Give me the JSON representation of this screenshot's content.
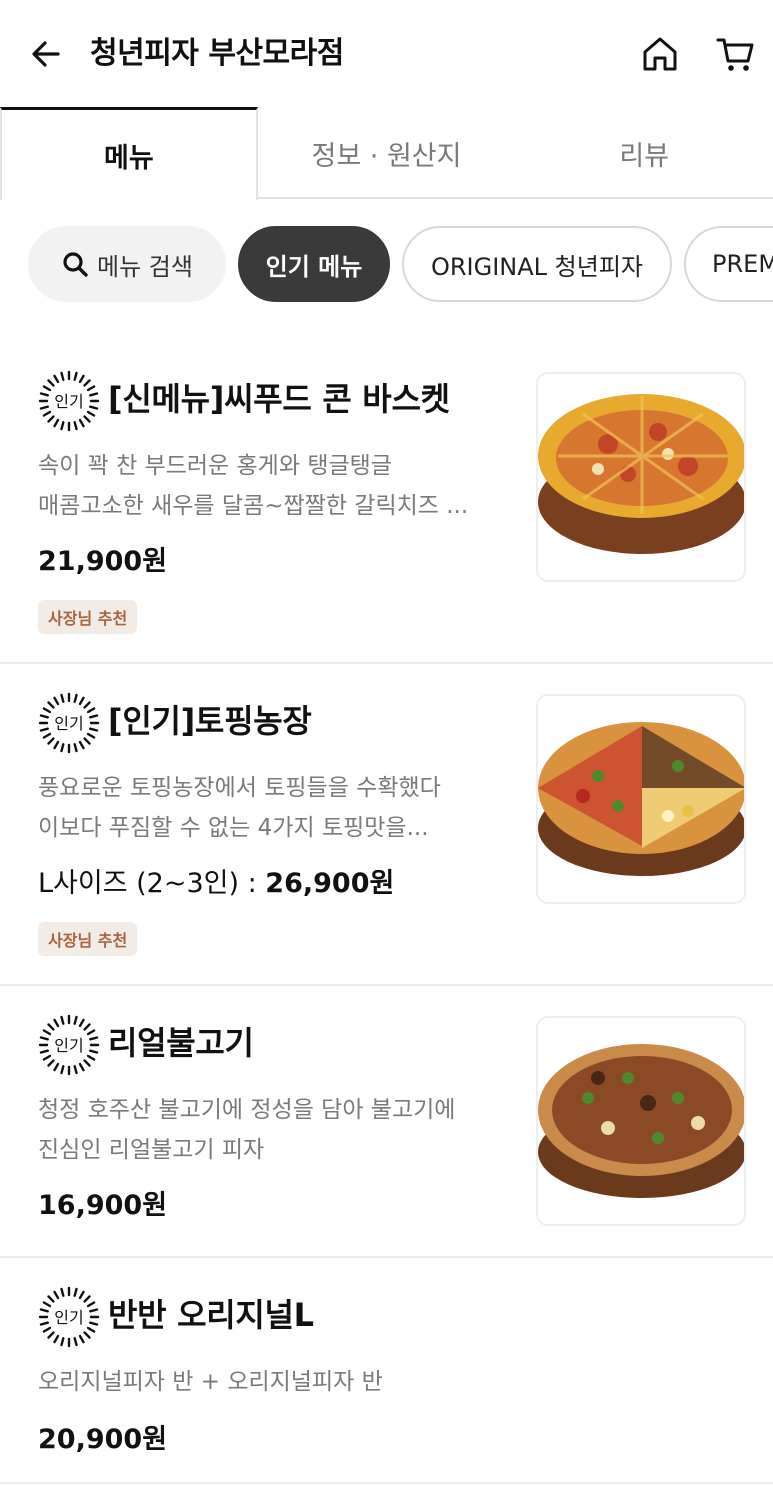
{
  "header": {
    "title": "청년피자 부산모라점",
    "back_icon": "back-arrow-icon",
    "home_icon": "home-icon",
    "cart_icon": "cart-icon"
  },
  "tabs": [
    {
      "label": "메뉴",
      "active": true
    },
    {
      "label": "정보 · 원산지",
      "active": false
    },
    {
      "label": "리뷰",
      "active": false
    }
  ],
  "chips": {
    "search_label": "메뉴 검색",
    "items": [
      {
        "label": "인기 메뉴",
        "active": true
      },
      {
        "label": "ORIGINAL 청년피자",
        "active": false
      },
      {
        "label": "PREMIUM",
        "active": false
      }
    ]
  },
  "badge_text": "인기",
  "menu": [
    {
      "name": "[신메뉴]씨푸드 콘 바스켓",
      "desc_lines": [
        "속이 꽉 찬 부드러운 홍게와 탱글탱글",
        "매콤고소한 새우를 달콤~짭짤한 갈릭치즈 ..."
      ],
      "price_prefix": "",
      "price": "21,900원",
      "recommend": "사장님 추천",
      "pizza_color": "#e5a52f"
    },
    {
      "name": "[인기]토핑농장",
      "desc_lines": [
        "풍요로운 토핑농장에서 토핑들을 수확했다",
        "이보다 푸짐할 수 없는 4가지 토핑맛을..."
      ],
      "price_prefix": "L사이즈 (2~3인) : ",
      "price": "26,900원",
      "recommend": "사장님 추천",
      "pizza_color": "#d98a3a"
    },
    {
      "name": "리얼불고기",
      "desc_lines": [
        "청정 호주산 불고기에 정성을 담아 불고기에",
        "진심인 리얼불고기 피자"
      ],
      "price_prefix": "",
      "price": "16,900원",
      "recommend": "",
      "pizza_color": "#c98a4a"
    },
    {
      "name": "반반 오리지널L",
      "desc_lines": [
        "오리지널피자 반 + 오리지널피자 반"
      ],
      "price_prefix": "",
      "price": "20,900원",
      "recommend": "",
      "pizza_color": ""
    }
  ]
}
